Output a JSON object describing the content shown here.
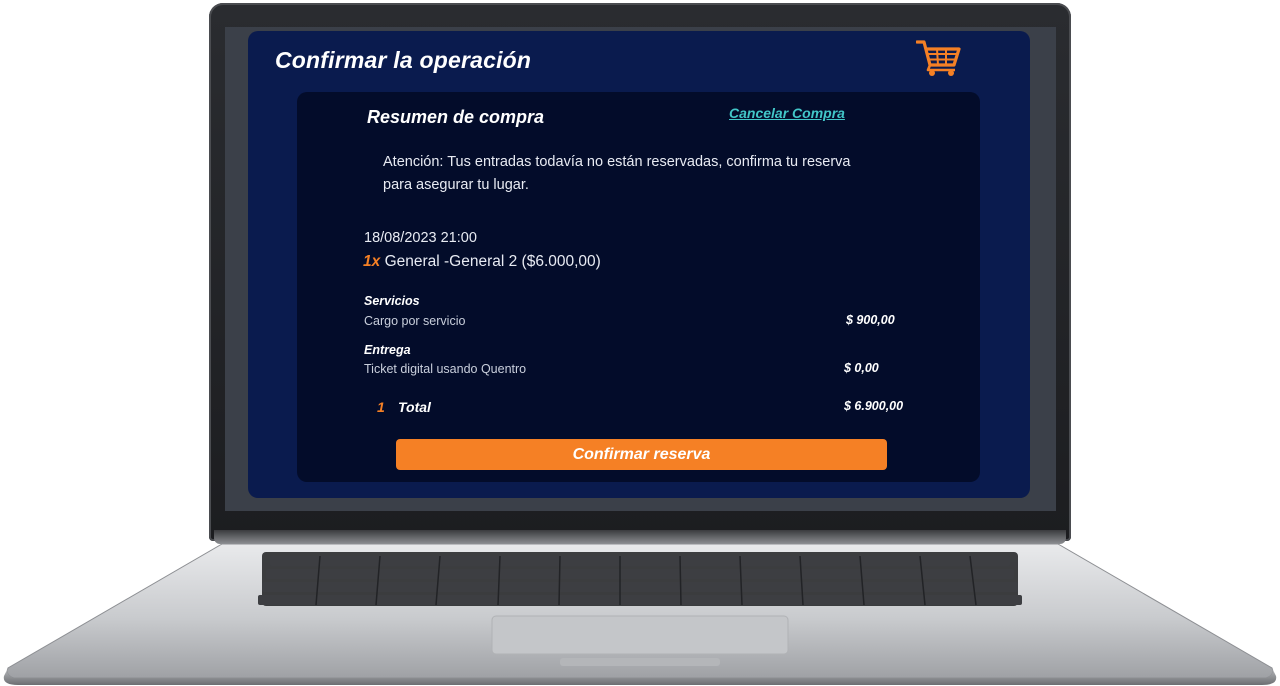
{
  "header": {
    "title": "Confirmar la operación",
    "cart_icon": "shopping-cart-icon",
    "accent_color": "#f58025"
  },
  "summary": {
    "title": "Resumen de compra",
    "cancel_label": "Cancelar Compra",
    "notice": "Atención: Tus entradas todavía no están reservadas, confirma tu reserva para asegurar tu lugar.",
    "datetime": "18/08/2023 21:00",
    "ticket_qty": "1x",
    "ticket_desc": "General -General 2 ($6.000,00)"
  },
  "services": {
    "label": "Servicios",
    "desc": "Cargo por servicio",
    "amount": "$ 900,00"
  },
  "delivery": {
    "label": "Entrega",
    "desc": "Ticket digital usando Quentro",
    "amount": "$ 0,00"
  },
  "total": {
    "count": "1",
    "label": "Total",
    "amount": "$ 6.900,00"
  },
  "actions": {
    "confirm_label": "Confirmar reserva"
  }
}
